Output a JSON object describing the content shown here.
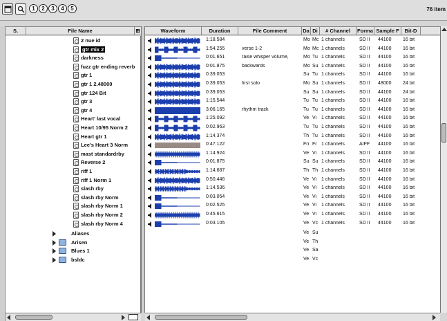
{
  "toolbar": {
    "buttons": [
      "1",
      "2",
      "3",
      "4",
      "5"
    ],
    "item_count": "76 item"
  },
  "columns": {
    "number": "S.",
    "file_name": "File Name",
    "waveform": "Waveform",
    "duration": "Duration",
    "comment": "File Comment",
    "da": "Da",
    "di": "Di",
    "channels": "# Channel",
    "format": "Forma",
    "sample": "Sample F",
    "bitd": "Bit-D"
  },
  "files": [
    {
      "name": "2 nue id",
      "duration": "1:18.584",
      "comment": "",
      "da": "Mo",
      "di": "Mc",
      "channels": "1 channels",
      "format": "SD II",
      "sample": "44100",
      "bit": "16 bit",
      "wave": "dense"
    },
    {
      "name": "gtr mix 2",
      "duration": "1:54.255",
      "comment": "verse 1-2",
      "da": "Mo",
      "di": "Mc",
      "channels": "1 channels",
      "format": "SD II",
      "sample": "44100",
      "bit": "16 bit",
      "wave": "burst",
      "selected": true
    },
    {
      "name": "darkness",
      "duration": "0:01.651",
      "comment": "raise whisper volume,",
      "da": "Mo",
      "di": "Tu",
      "channels": "1 channels",
      "format": "SD II",
      "sample": "44100",
      "bit": "16 bit",
      "wave": "short"
    },
    {
      "name": "fuzz gtr ending reverb",
      "duration": "0:01.875",
      "comment": "backwards",
      "da": "Mo",
      "di": "Su",
      "channels": "1 channels",
      "format": "SD II",
      "sample": "44100",
      "bit": "16 bit",
      "wave": "dense"
    },
    {
      "name": "gtr 1",
      "duration": "0:39.053",
      "comment": "",
      "da": "Su",
      "di": "Tu",
      "channels": "1 channels",
      "format": "SD II",
      "sample": "44100",
      "bit": "16 bit",
      "wave": "dense"
    },
    {
      "name": "gtr 1 2.48000",
      "duration": "0:39.053",
      "comment": "first solo",
      "da": "Mo",
      "di": "Su",
      "channels": "1 channels",
      "format": "SD II",
      "sample": "48000",
      "bit": "24 bit",
      "wave": "dense"
    },
    {
      "name": "gtr 124 Bit",
      "duration": "0:39.053",
      "comment": "",
      "da": "Su",
      "di": "Su",
      "channels": "1 channels",
      "format": "SD II",
      "sample": "44100",
      "bit": "24 bit",
      "wave": "dense"
    },
    {
      "name": "gtr 3",
      "duration": "1:15.544",
      "comment": "",
      "da": "Tu",
      "di": "Tu",
      "channels": "1 channels",
      "format": "SD II",
      "sample": "44100",
      "bit": "16 bit",
      "wave": "dense"
    },
    {
      "name": "gtr 4",
      "duration": "3:06.165",
      "comment": "rhythm track",
      "da": "Tu",
      "di": "Tu",
      "channels": "1 channels",
      "format": "SD II",
      "sample": "44100",
      "bit": "16 bit",
      "wave": "full"
    },
    {
      "name": "Heart' last vocal",
      "duration": "1:25.092",
      "comment": "",
      "da": "Ve",
      "di": "Vi",
      "channels": "1 channels",
      "format": "SD II",
      "sample": "44100",
      "bit": "16 bit",
      "wave": "burst"
    },
    {
      "name": "Heart 10/95 Norm 2",
      "duration": "0:02.963",
      "comment": "",
      "da": "Tu",
      "di": "Tu",
      "channels": "1 channels",
      "format": "SD II",
      "sample": "44100",
      "bit": "16 bit",
      "wave": "burst"
    },
    {
      "name": "Heart gtr 1",
      "duration": "1:14.374",
      "comment": "",
      "da": "Th",
      "di": "Tu",
      "channels": "1 channels",
      "format": "SD II",
      "sample": "44100",
      "bit": "16 bit",
      "wave": "dense"
    },
    {
      "name": "Lee's Heart 3 Norm",
      "duration": "0:47.122",
      "comment": "",
      "da": "Fri",
      "di": "Fr",
      "channels": "1 channels",
      "format": "AIFF",
      "sample": "44100",
      "bit": "16 bit",
      "wave": "flat"
    },
    {
      "name": "mast standardrby",
      "duration": "1:14.924",
      "comment": "",
      "da": "Ve",
      "di": "Vi",
      "channels": "1 channels",
      "format": "SD II",
      "sample": "44100",
      "bit": "16 bit",
      "wave": "striped"
    },
    {
      "name": "Reverse 2",
      "duration": "0:01.875",
      "comment": "",
      "da": "Su",
      "di": "Su",
      "channels": "1 channels",
      "format": "SD II",
      "sample": "44100",
      "bit": "16 bit",
      "wave": "short"
    },
    {
      "name": "riff 1",
      "duration": "1:14.687",
      "comment": "",
      "da": "Th",
      "di": "Th",
      "channels": "1 channels",
      "format": "SD II",
      "sample": "44100",
      "bit": "16 bit",
      "wave": "sparse"
    },
    {
      "name": "riff 1 Norm 1",
      "duration": "0:50.446",
      "comment": "",
      "da": "Ve",
      "di": "Vi",
      "channels": "1 channels",
      "format": "SD II",
      "sample": "44100",
      "bit": "16 bit",
      "wave": "dense"
    },
    {
      "name": "slash rby",
      "duration": "1:14.536",
      "comment": "",
      "da": "Ve",
      "di": "Vi",
      "channels": "1 channels",
      "format": "SD II",
      "sample": "44100",
      "bit": "16 bit",
      "wave": "sparse"
    },
    {
      "name": "slash rby Norm",
      "duration": "0:03.054",
      "comment": "",
      "da": "Ve",
      "di": "Vi",
      "channels": "1 channels",
      "format": "SD II",
      "sample": "44100",
      "bit": "16 bit",
      "wave": "short"
    },
    {
      "name": "slash rby Norm 1",
      "duration": "0:02.525",
      "comment": "",
      "da": "Ve",
      "di": "Vi",
      "channels": "1 channels",
      "format": "SD II",
      "sample": "44100",
      "bit": "16 bit",
      "wave": "short"
    },
    {
      "name": "slash rby Norm 2",
      "duration": "0:45.615",
      "comment": "",
      "da": "Ve",
      "di": "Vi",
      "channels": "1 channels",
      "format": "SD II",
      "sample": "44100",
      "bit": "16 bit",
      "wave": "striped"
    },
    {
      "name": "slash rby Norm 4",
      "duration": "0:03.105",
      "comment": "",
      "da": "Ve",
      "di": "Vc",
      "channels": "1 channels",
      "format": "SD II",
      "sample": "44100",
      "bit": "16 bit",
      "wave": "short"
    }
  ],
  "folders": [
    {
      "name": "Aliases",
      "da": "Ve",
      "di": "Su",
      "icon": false
    },
    {
      "name": "Arisen",
      "da": "Ve",
      "di": "Th",
      "icon": true
    },
    {
      "name": "Blues 1",
      "da": "Ve",
      "di": "Sa",
      "icon": true
    },
    {
      "name": "bsldc",
      "da": "Ve",
      "di": "Vc",
      "icon": true
    }
  ],
  "colors": {
    "wave": "#1c3fae",
    "wave_flat": "#9a8a86"
  }
}
